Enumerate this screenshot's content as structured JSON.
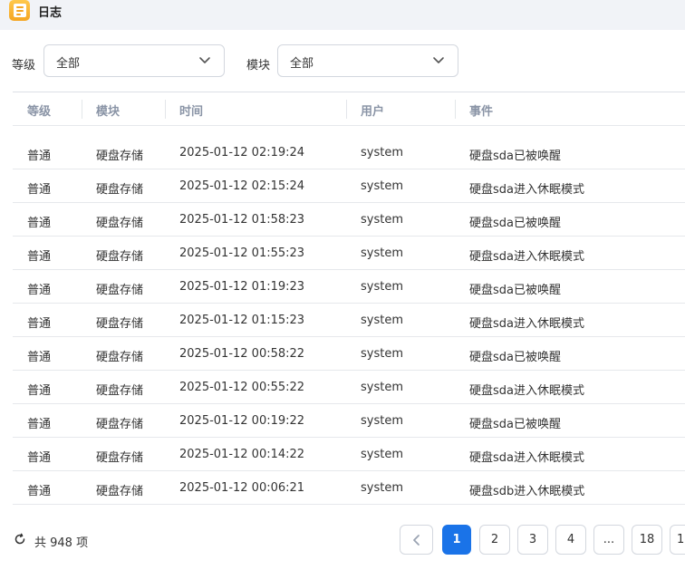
{
  "window": {
    "title": "日志"
  },
  "filters": {
    "level": {
      "label": "等级",
      "value": "全部"
    },
    "module": {
      "label": "模块",
      "value": "全部"
    }
  },
  "table": {
    "columns": [
      "等级",
      "模块",
      "时间",
      "用户",
      "事件"
    ],
    "rows": [
      [
        "普通",
        "硬盘存储",
        "2025-01-12 02:19:24",
        "system",
        "硬盘sda已被唤醒"
      ],
      [
        "普通",
        "硬盘存储",
        "2025-01-12 02:15:24",
        "system",
        "硬盘sda进入休眠模式"
      ],
      [
        "普通",
        "硬盘存储",
        "2025-01-12 01:58:23",
        "system",
        "硬盘sda已被唤醒"
      ],
      [
        "普通",
        "硬盘存储",
        "2025-01-12 01:55:23",
        "system",
        "硬盘sda进入休眠模式"
      ],
      [
        "普通",
        "硬盘存储",
        "2025-01-12 01:19:23",
        "system",
        "硬盘sda已被唤醒"
      ],
      [
        "普通",
        "硬盘存储",
        "2025-01-12 01:15:23",
        "system",
        "硬盘sda进入休眠模式"
      ],
      [
        "普通",
        "硬盘存储",
        "2025-01-12 00:58:22",
        "system",
        "硬盘sda已被唤醒"
      ],
      [
        "普通",
        "硬盘存储",
        "2025-01-12 00:55:22",
        "system",
        "硬盘sda进入休眠模式"
      ],
      [
        "普通",
        "硬盘存储",
        "2025-01-12 00:19:22",
        "system",
        "硬盘sda已被唤醒"
      ],
      [
        "普通",
        "硬盘存储",
        "2025-01-12 00:14:22",
        "system",
        "硬盘sda进入休眠模式"
      ],
      [
        "普通",
        "硬盘存储",
        "2025-01-12 00:06:21",
        "system",
        "硬盘sdb进入休眠模式"
      ]
    ]
  },
  "footer": {
    "total": "共 948 项",
    "pages": [
      "1",
      "2",
      "3",
      "4",
      "...",
      "18",
      "1"
    ],
    "current_page": "1"
  },
  "colors": {
    "accent": "#1a73e8",
    "app_icon": "#f5a623",
    "header_text": "#8a94a6"
  }
}
